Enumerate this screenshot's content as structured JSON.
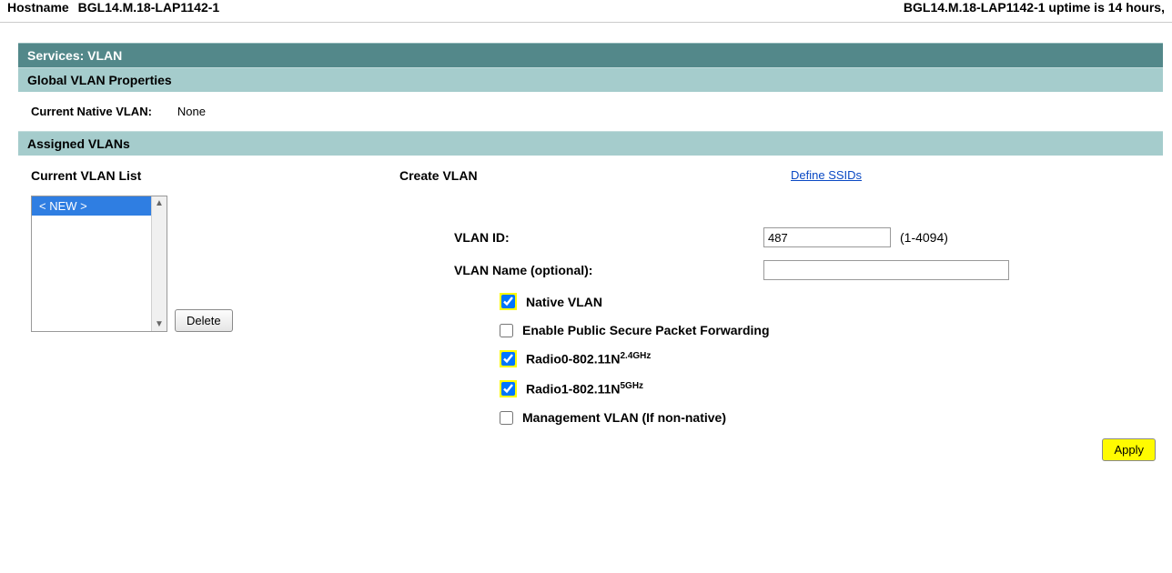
{
  "topbar": {
    "hostname_label": "Hostname",
    "hostname_value": "BGL14.M.18-LAP1142-1",
    "uptime_text": "BGL14.M.18-LAP1142-1 uptime is 14 hours,"
  },
  "headers": {
    "services_vlan": "Services: VLAN",
    "global_props": "Global VLAN Properties",
    "assigned_vlans": "Assigned VLANs"
  },
  "globals": {
    "native_vlan_label": "Current Native VLAN:",
    "native_vlan_value": "None"
  },
  "left": {
    "list_heading": "Current VLAN List",
    "items": [
      "< NEW >"
    ],
    "delete_label": "Delete"
  },
  "mid": {
    "heading": "Create VLAN",
    "vlan_id_label": "VLAN ID:",
    "vlan_name_label": "VLAN Name (optional):",
    "vlan_id_value": "487",
    "vlan_id_hint": "(1-4094)",
    "vlan_name_value": "",
    "cb_native": "Native VLAN",
    "cb_pspf": "Enable Public Secure Packet Forwarding",
    "radio0_prefix": "Radio0-802.11N",
    "radio0_sup": "2.4GHz",
    "radio1_prefix": "Radio1-802.11N",
    "radio1_sup": "5GHz",
    "cb_mgmt": "Management VLAN (If non-native)"
  },
  "right": {
    "define_ssids": "Define SSIDs"
  },
  "footer": {
    "apply": "Apply"
  }
}
